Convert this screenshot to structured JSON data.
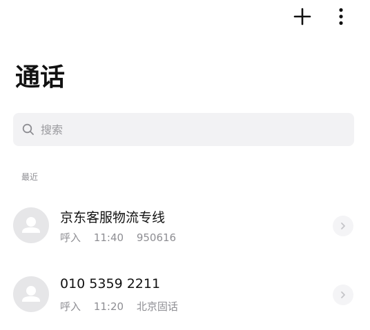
{
  "toolbar": {
    "add_icon": "plus-icon",
    "more_icon": "vertical-ellipsis-icon"
  },
  "page": {
    "title": "通话"
  },
  "search": {
    "placeholder": "搜索",
    "icon": "search-icon"
  },
  "recent": {
    "label": "最近",
    "items": [
      {
        "name": "京东客服物流专线",
        "direction": "呼入",
        "time": "11:40",
        "detail": "950616"
      },
      {
        "name": "010 5359 2211",
        "direction": "呼入",
        "time": "11:20",
        "detail": "北京固话"
      }
    ]
  },
  "colors": {
    "background": "#ffffff",
    "search_bg": "#f2f2f4",
    "secondary_text": "#8e8e93",
    "avatar_bg": "#e6e6e8"
  }
}
